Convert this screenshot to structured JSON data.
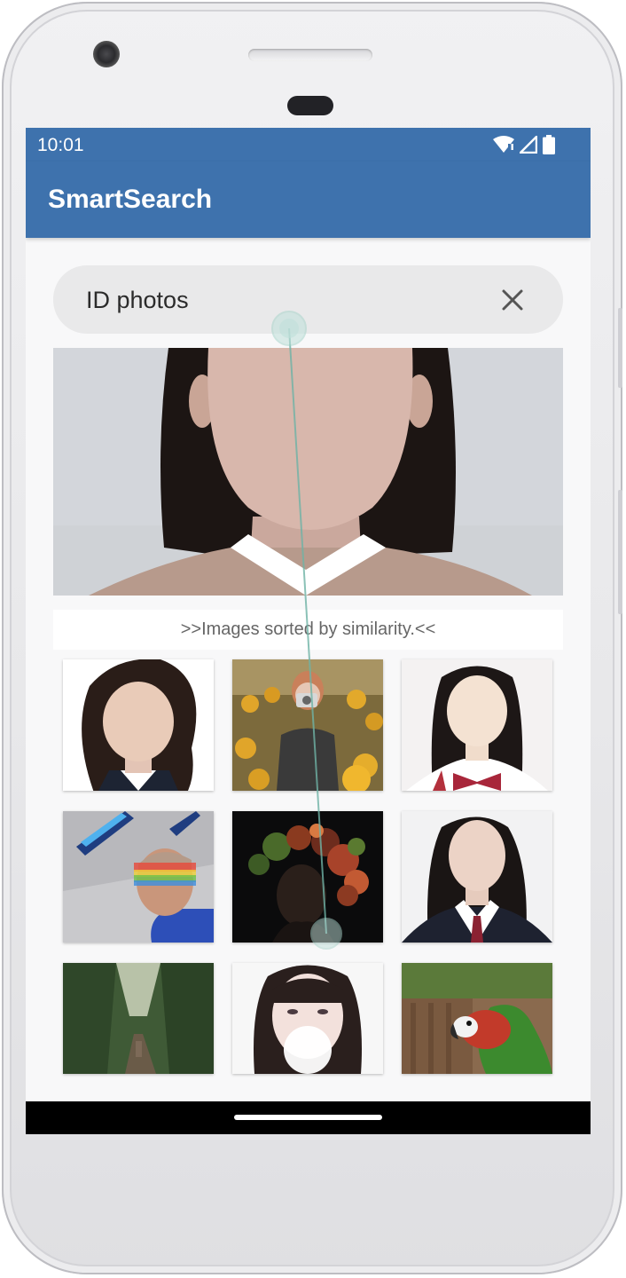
{
  "status_bar": {
    "time": "10:01",
    "icons": [
      "wifi-icon",
      "signal-icon",
      "battery-icon"
    ]
  },
  "app_bar": {
    "title": "SmartSearch",
    "color": "#3e72ad"
  },
  "search": {
    "query": "ID photos",
    "clear_icon": "close-icon"
  },
  "results": {
    "sort_label": ">>Images sorted by similarity.<<",
    "thumbnails": [
      {
        "subject": "woman-id-photo-wavy-hair"
      },
      {
        "subject": "woman-camera-sunflowers"
      },
      {
        "subject": "girl-id-photo-bow-tie"
      },
      {
        "subject": "man-rainbow-light"
      },
      {
        "subject": "woman-flower-crown-dark"
      },
      {
        "subject": "girl-id-photo-red-tie"
      },
      {
        "subject": "forest-path-person"
      },
      {
        "subject": "girl-id-photo-bangs"
      },
      {
        "subject": "parrot-macaw"
      }
    ]
  }
}
